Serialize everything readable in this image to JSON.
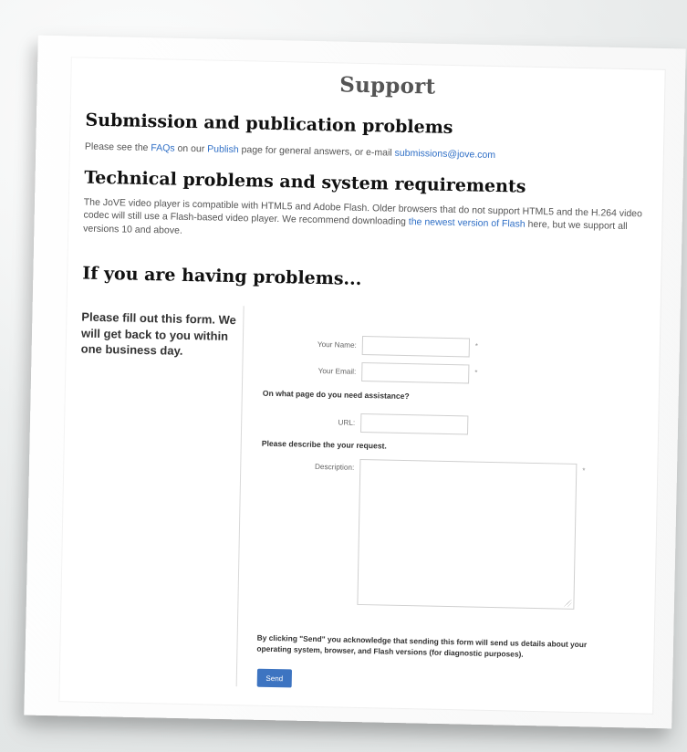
{
  "page": {
    "title": "Support"
  },
  "sections": {
    "submission_title": "Submission and publication problems",
    "submission_text_before_faqs": "Please see the ",
    "submission_faqs_link": "FAQs",
    "submission_text_middle": " on our ",
    "submission_publish_link": "Publish",
    "submission_text_after_publish": " page for general answers, or e-mail ",
    "submission_email_link": "submissions@jove.com",
    "technical_title": "Technical problems and system requirements",
    "technical_text_before_link": "The JoVE video player is compatible with HTML5 and Adobe Flash. Older browsers that do not support HTML5 and the H.264 video codec will still use a Flash-based video player. We recommend downloading ",
    "technical_link": "the newest version of Flash",
    "technical_text_after_link": " here, but we support all versions 10 and above.",
    "problems_title": "If you are having problems..."
  },
  "form": {
    "lead_text": "Please fill out this form. We will get back to you within one business day.",
    "name_label": "Your Name:",
    "email_label": "Your Email:",
    "required_marker": "*",
    "page_prompt": "On what page do you need assistance?",
    "url_label": "URL:",
    "request_prompt": "Please describe the your request.",
    "description_label": "Description:",
    "acknowledgement": "By clicking \"Send\" you acknowledge that sending this form will send us details about your operating system, browser, and Flash versions (for diagnostic purposes).",
    "send_label": "Send"
  },
  "colors": {
    "link": "#2f6fc6",
    "button": "#3d74c1"
  }
}
